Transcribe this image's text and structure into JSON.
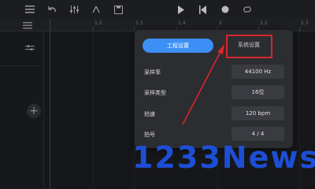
{
  "toolbar": {
    "icons": [
      "menu-icon",
      "undo-icon",
      "mixer-icon",
      "tools-icon",
      "save-icon",
      "play-icon",
      "rewind-icon",
      "record-icon",
      "loop-icon"
    ]
  },
  "ruler": {
    "numbers": [
      "1.2",
      "1.3",
      "1.4",
      "2",
      "2.2",
      "2.3"
    ]
  },
  "dialog": {
    "tabs": {
      "project": "工程设置",
      "system": "系统设置"
    },
    "rows": [
      {
        "label": "采样率",
        "value": "44100 Hz"
      },
      {
        "label": "采样类型",
        "value": "16位"
      },
      {
        "label": "拍速",
        "value": "120 bpm"
      },
      {
        "label": "拍号",
        "value": "4 / 4"
      }
    ]
  },
  "watermark": "1233News",
  "colors": {
    "accent": "#3d8ff5",
    "highlight": "#d8262a",
    "watermark": "#1d4fd6"
  }
}
